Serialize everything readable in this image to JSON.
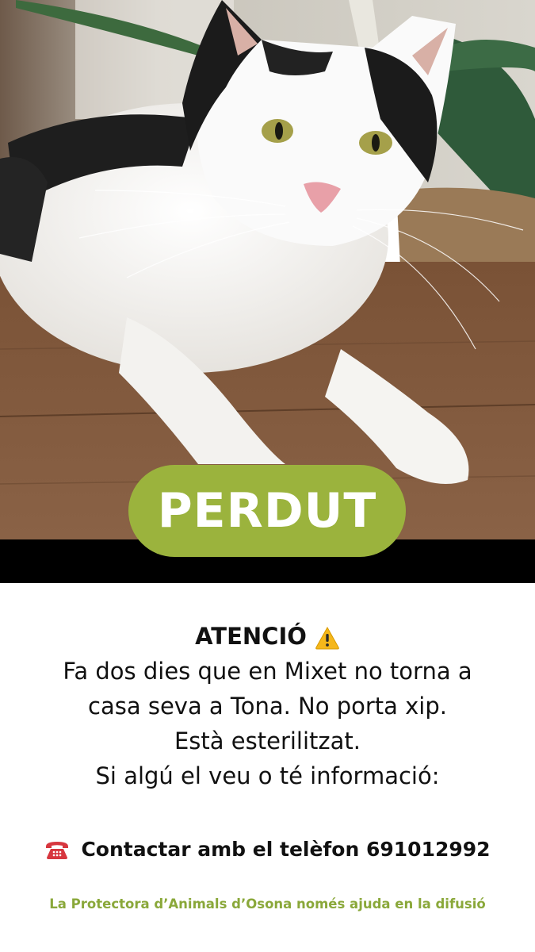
{
  "badge": {
    "label": "PERDUT"
  },
  "notice": {
    "title": "ATENCIÓ",
    "lines": [
      "Fa dos dies que en Mixet no torna a",
      "casa seva a Tona. No porta xip.",
      "Està esterilitzat.",
      "Si algú el veu o té informació:"
    ]
  },
  "contact": {
    "text": "Contactar amb el telèfon 691012992",
    "icon": "telephone-icon"
  },
  "footer": {
    "text": "La Protectora d’Animals d’Osona només ajuda en la difusió"
  },
  "icons": {
    "warning": "warning-icon"
  },
  "colors": {
    "accent": "#9bb33d",
    "footer_text": "#8aa83a",
    "band": "#000000",
    "phone": "#d7373f"
  }
}
